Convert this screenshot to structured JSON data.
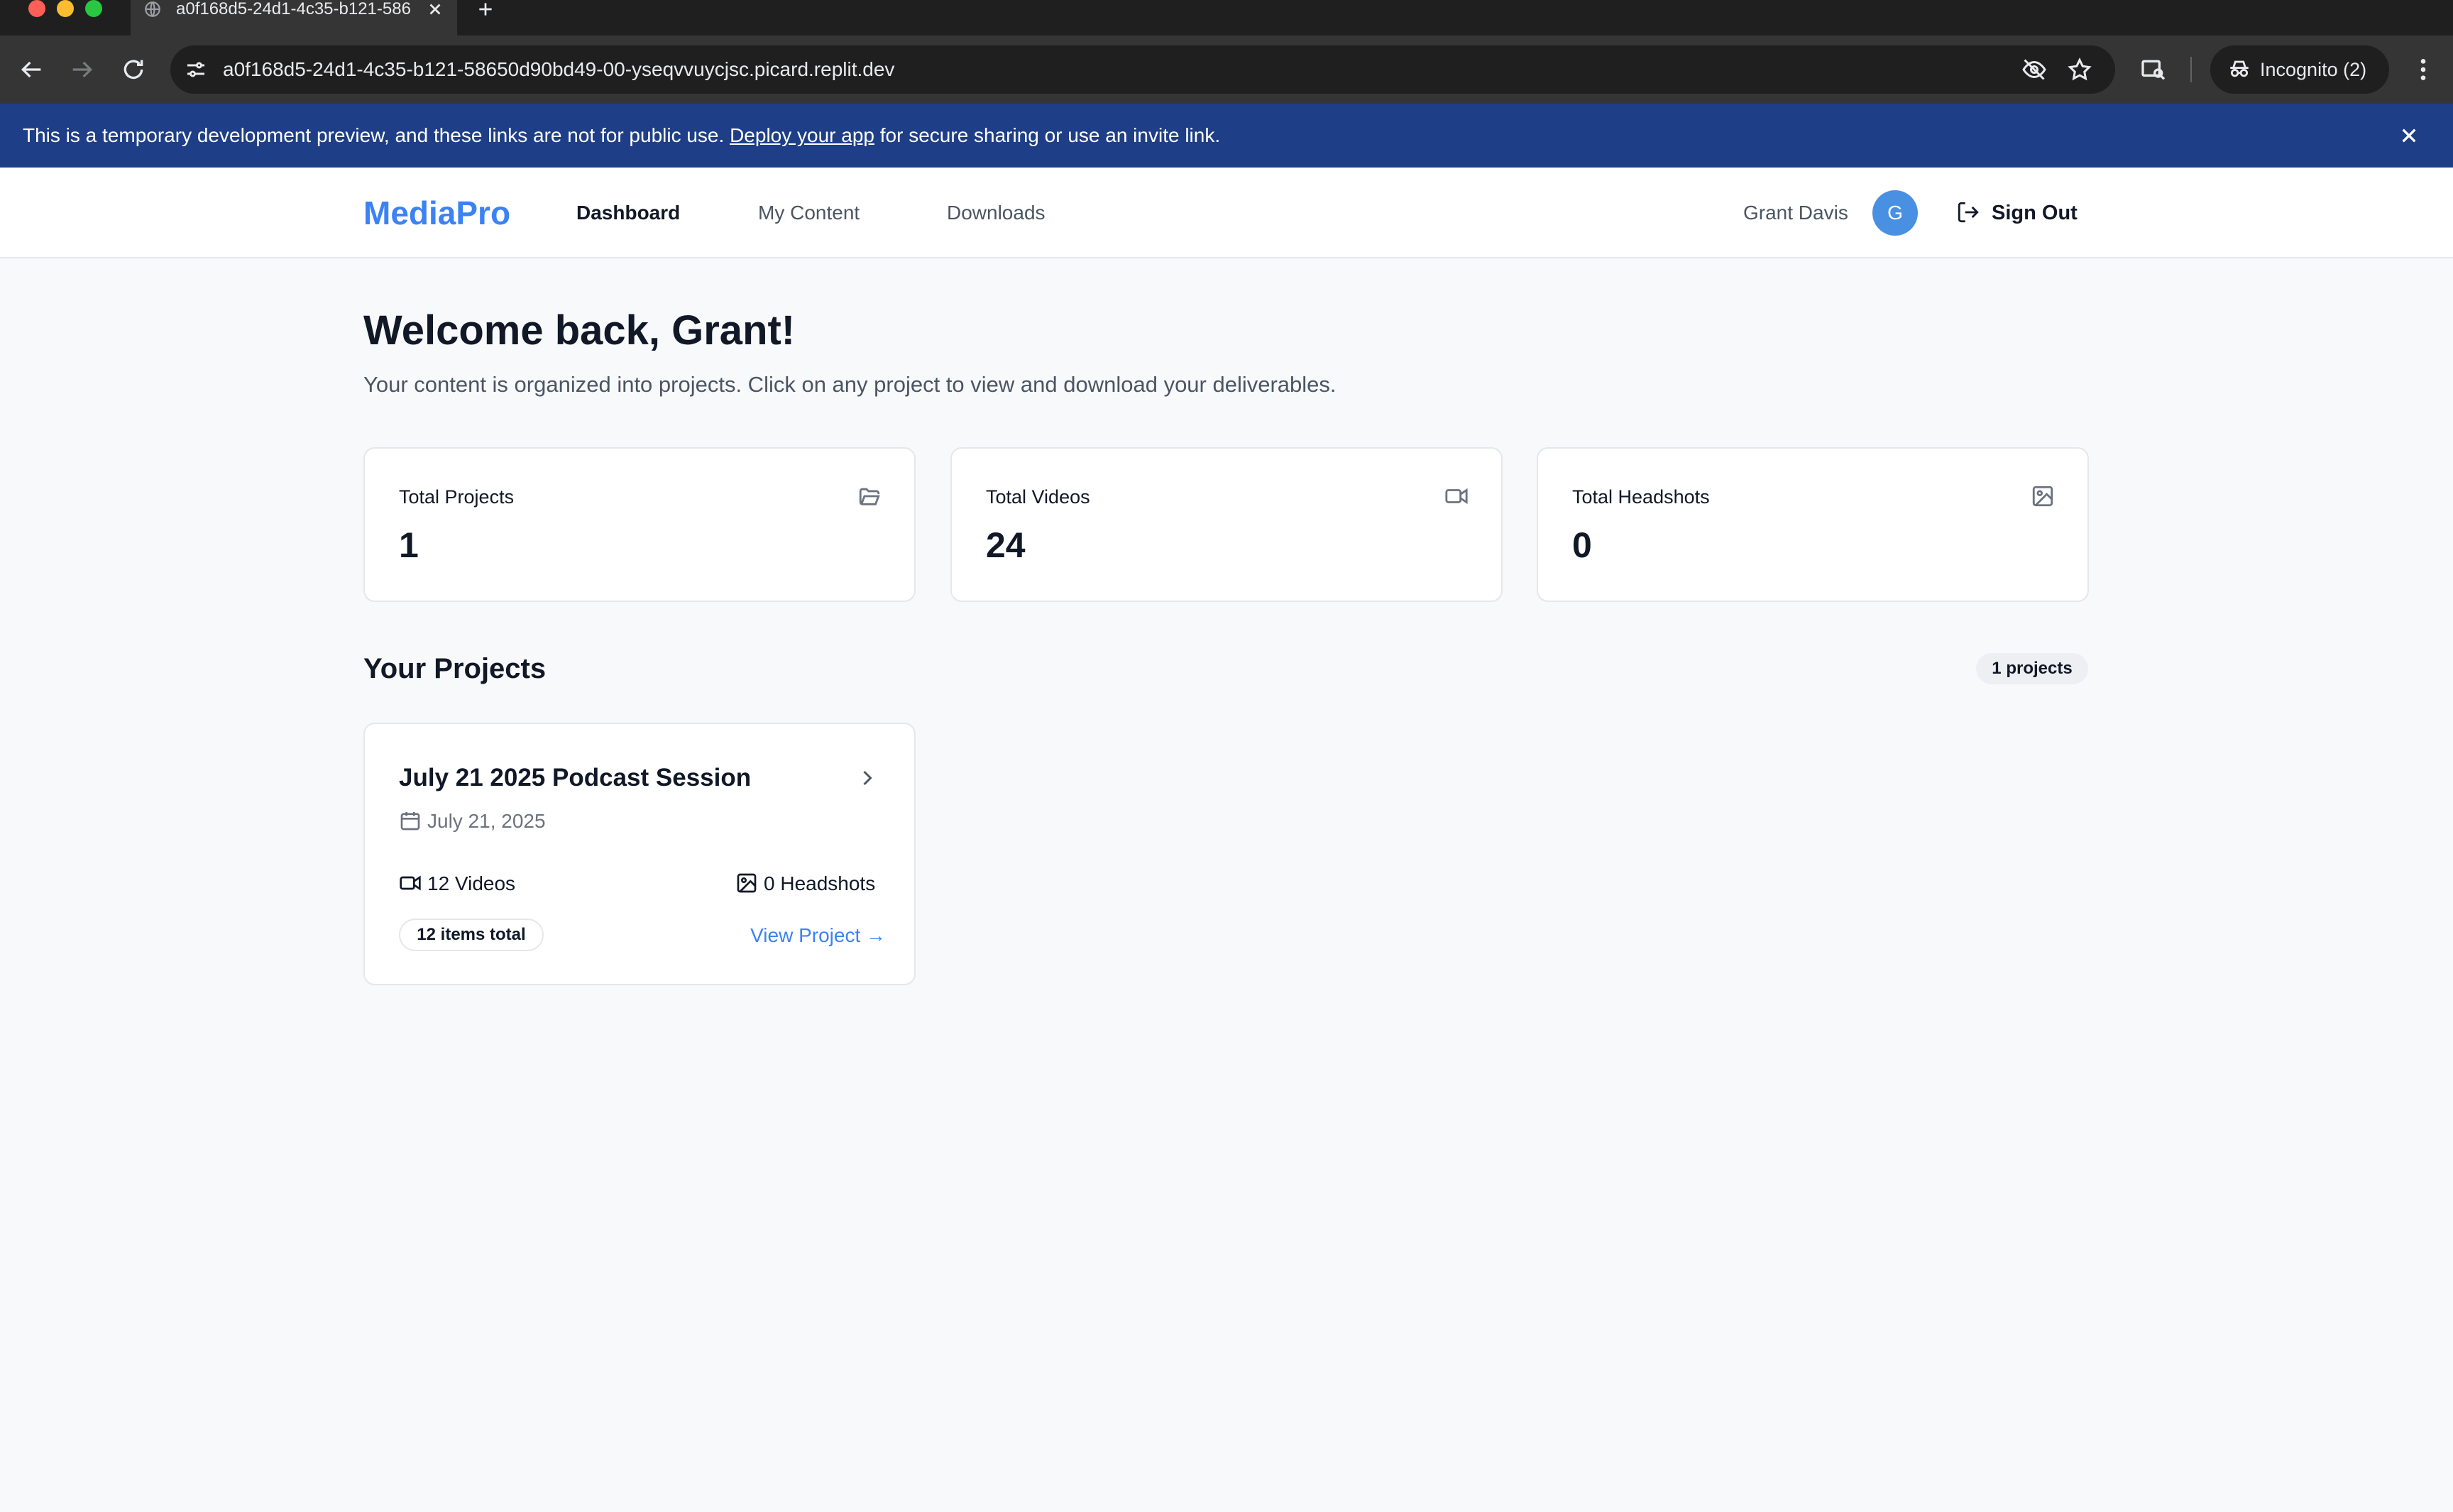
{
  "browser": {
    "tab_title": "a0f168d5-24d1-4c35-b121-58650d90bd49-00-yseqvvuycjsc.picard.replit.dev",
    "url": "a0f168d5-24d1-4c35-b121-58650d90bd49-00-yseqvvuycjsc.picard.replit.dev",
    "incognito_label": "Incognito (2)"
  },
  "banner": {
    "text_before": "This is a temporary development preview, and these links are not for public use. ",
    "link_text": "Deploy your app",
    "text_after": " for secure sharing or use an invite link."
  },
  "header": {
    "logo": "MediaPro",
    "nav": [
      {
        "label": "Dashboard",
        "active": true
      },
      {
        "label": "My Content",
        "active": false
      },
      {
        "label": "Downloads",
        "active": false
      }
    ],
    "user_name": "Grant Davis",
    "avatar_initial": "G",
    "sign_out_label": "Sign Out"
  },
  "main": {
    "welcome": "Welcome back, Grant!",
    "subtitle": "Your content is organized into projects. Click on any project to view and download your deliverables.",
    "stats": [
      {
        "label": "Total Projects",
        "value": "1",
        "icon": "folder-icon"
      },
      {
        "label": "Total Videos",
        "value": "24",
        "icon": "video-icon"
      },
      {
        "label": "Total Headshots",
        "value": "0",
        "icon": "image-icon"
      }
    ],
    "projects_title": "Your Projects",
    "projects_count": "1 projects",
    "projects": [
      {
        "title": "July 21 2025 Podcast Session",
        "date": "July 21, 2025",
        "videos": "12 Videos",
        "headshots": "0 Headshots",
        "items_total": "12 items total",
        "view_label": "View Project →"
      }
    ]
  },
  "colors": {
    "brand": "#3b82f6",
    "banner_bg": "#1e3f87",
    "avatar_bg": "#4a90e2",
    "page_bg": "#f8f9fb"
  }
}
